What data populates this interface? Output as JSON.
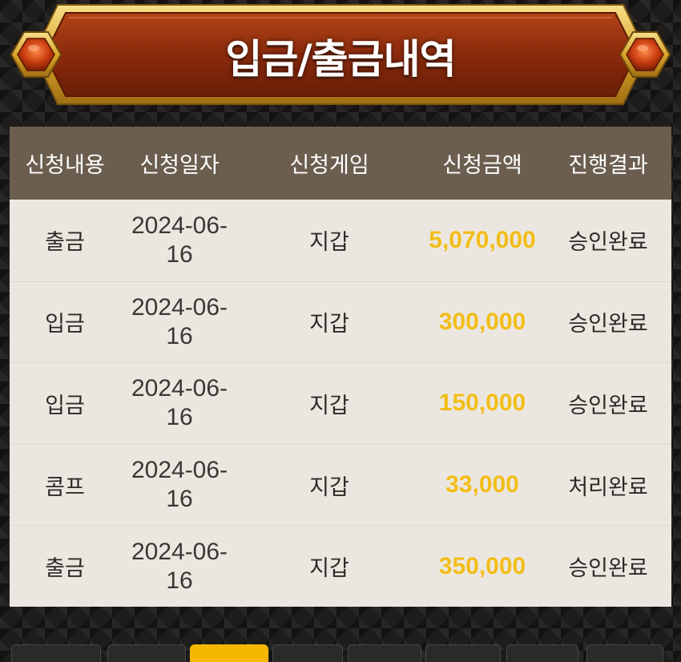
{
  "header": {
    "title": "입금/출금내역"
  },
  "table": {
    "columns": [
      "신청내용",
      "신청일자",
      "신청게임",
      "신청금액",
      "진행결과"
    ],
    "rows": [
      {
        "type": "출금",
        "date": "2024-06-16",
        "game": "지갑",
        "amount": "5,070,000",
        "status": "승인완료"
      },
      {
        "type": "입금",
        "date": "2024-06-16",
        "game": "지갑",
        "amount": "300,000",
        "status": "승인완료"
      },
      {
        "type": "입금",
        "date": "2024-06-16",
        "game": "지갑",
        "amount": "150,000",
        "status": "승인완료"
      },
      {
        "type": "콤프",
        "date": "2024-06-16",
        "game": "지갑",
        "amount": "33,000",
        "status": "처리완료"
      },
      {
        "type": "출금",
        "date": "2024-06-16",
        "game": "지갑",
        "amount": "350,000",
        "status": "승인완료"
      }
    ]
  },
  "pagination": {
    "active_index": 2,
    "count": 7
  },
  "colors": {
    "amount": "#f3bd17",
    "header_bg": "#6b5e4f",
    "banner_red": "#8a2a0c",
    "banner_gold": "#e9b93a",
    "active_tab": "#f5b800"
  }
}
